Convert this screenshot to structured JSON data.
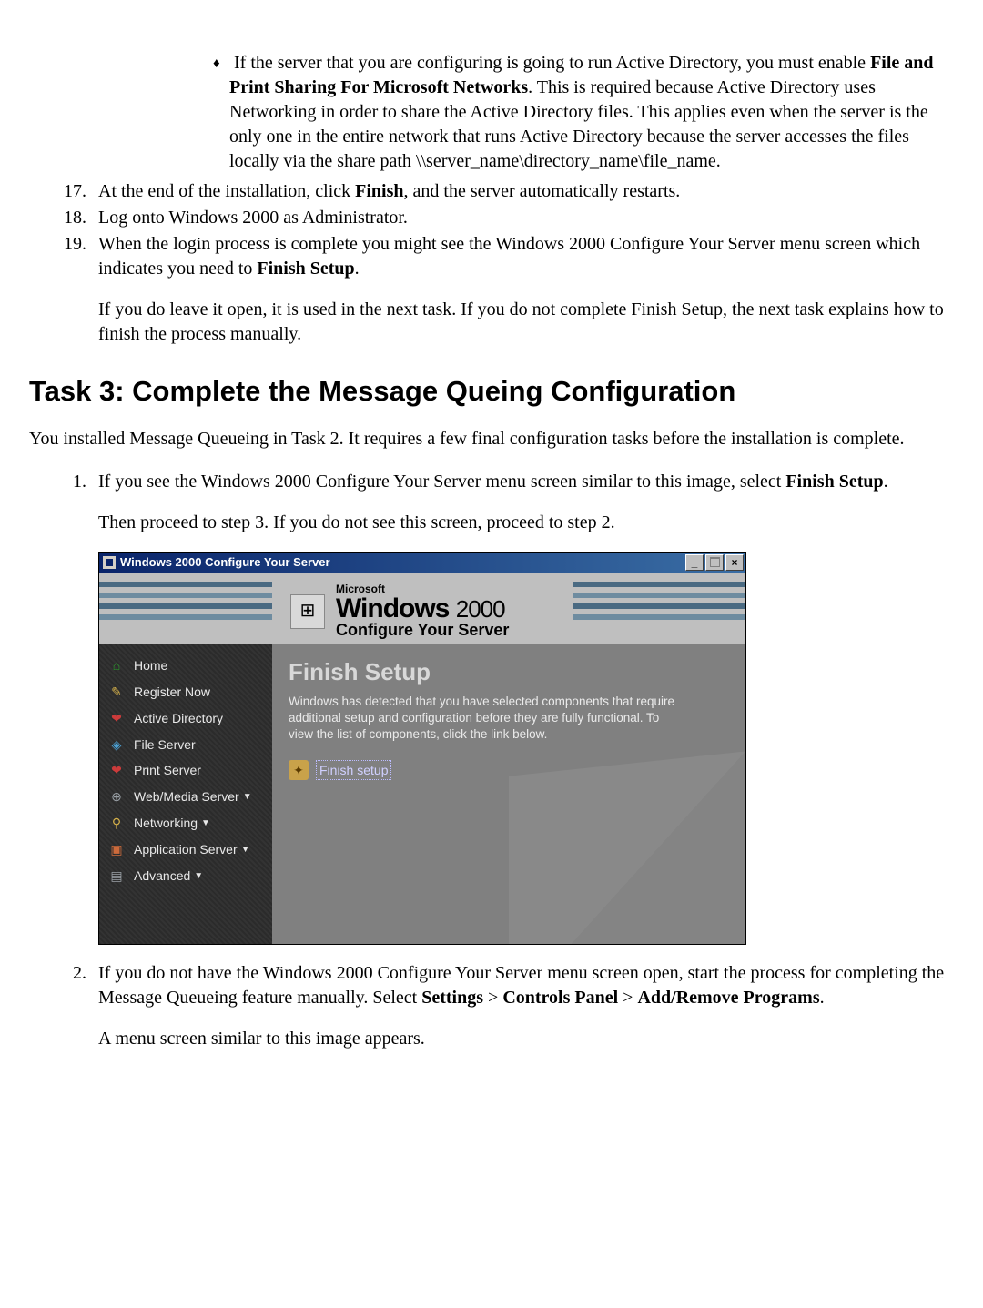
{
  "top_list": {
    "start": 17,
    "bullet": {
      "text_a": "If the server that you are configuring is going to run Active Directory, you must enable ",
      "bold_a": "File and Print Sharing For Microsoft Networks",
      "text_b": ". This is required because Active Directory uses Networking in order to share the Active Directory files. This applies even when the server is the only one in the entire network that runs Active Directory because the server accesses the files locally via the share path \\\\server_name\\directory_name\\file_name."
    },
    "item17_a": "At the end of the installation, click ",
    "item17_bold": "Finish",
    "item17_b": ", and the server automatically restarts.",
    "item18": "Log onto Windows 2000 as Administrator.",
    "item19_a": "When the login process is complete you might see the Windows 2000 Configure Your Server menu screen which indicates you need to ",
    "item19_bold": "Finish Setup",
    "item19_b": ".",
    "item19_after": "If you do leave it open, it is used in the next task. If you do not complete Finish Setup, the next task explains how to finish the process manually."
  },
  "task_heading": "Task 3: Complete the Message Queing Configuration",
  "task_intro": "You installed Message Queueing in Task 2. It requires a few final configuration tasks before the installation is complete.",
  "steps": {
    "s1_a": "If you see the Windows 2000 Configure Your Server menu screen similar to this image, select ",
    "s1_bold": "Finish Setup",
    "s1_b": ".",
    "s1_after": "Then proceed to step 3. If you do not see this screen, proceed to step 2.",
    "s2_a": "If you do not have the Windows 2000 Configure Your Server menu screen open, start the process for completing the Message Queueing feature manually. Select ",
    "s2_b1": "Settings",
    "s2_gt1": " > ",
    "s2_b2": "Controls Panel",
    "s2_gt2": " > ",
    "s2_b3": "Add/Remove Programs",
    "s2_c": ".",
    "s2_after": "A menu screen similar to this image appears."
  },
  "window": {
    "title": "Windows 2000 Configure Your Server",
    "banner_ms": "Microsoft",
    "banner_main": "Windows",
    "banner_year": "2000",
    "banner_sub": "Configure Your Server",
    "sidebar": [
      {
        "label": "Home",
        "icon": "home",
        "dd": false
      },
      {
        "label": "Register Now",
        "icon": "reg",
        "dd": false
      },
      {
        "label": "Active Directory",
        "icon": "ad",
        "dd": false
      },
      {
        "label": "File Server",
        "icon": "fs",
        "dd": false
      },
      {
        "label": "Print Server",
        "icon": "ps",
        "dd": false
      },
      {
        "label": "Web/Media Server",
        "icon": "web",
        "dd": true
      },
      {
        "label": "Networking",
        "icon": "net",
        "dd": true
      },
      {
        "label": "Application Server",
        "icon": "app",
        "dd": true
      },
      {
        "label": "Advanced",
        "icon": "adv",
        "dd": true
      }
    ],
    "content_heading": "Finish Setup",
    "content_text": "Windows has detected that you have selected components that require additional setup and configuration before they are fully functional. To view the list of components, click the link below.",
    "finish_link": "Finish setup"
  }
}
